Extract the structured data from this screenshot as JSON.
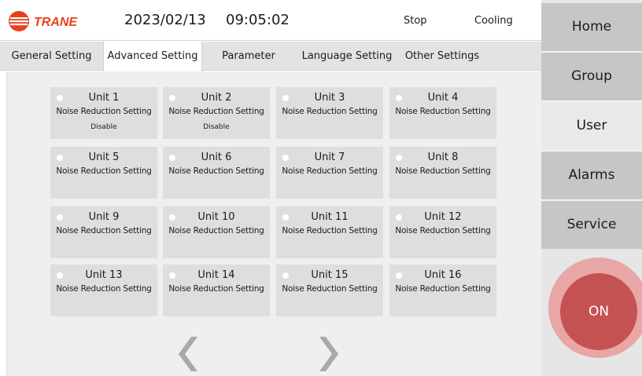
{
  "header": {
    "brand": "TRANE",
    "date": "2023/02/13",
    "time": "09:05:02",
    "status": "Stop",
    "mode": "Cooling"
  },
  "tabs": [
    {
      "label": "General Setting",
      "active": false
    },
    {
      "label": "Advanced Setting",
      "active": true
    },
    {
      "label": "Parameter",
      "active": false
    },
    {
      "label": "Language Setting",
      "active": false
    },
    {
      "label": "Other Settings",
      "active": false
    }
  ],
  "units": [
    {
      "name": "Unit 1",
      "setting": "Noise Reduction Setting",
      "value": "Disable"
    },
    {
      "name": "Unit 2",
      "setting": "Noise Reduction Setting",
      "value": "Disable"
    },
    {
      "name": "Unit 3",
      "setting": "Noise Reduction Setting",
      "value": ""
    },
    {
      "name": "Unit 4",
      "setting": "Noise Reduction Setting",
      "value": ""
    },
    {
      "name": "Unit 5",
      "setting": "Noise Reduction Setting",
      "value": ""
    },
    {
      "name": "Unit 6",
      "setting": "Noise Reduction Setting",
      "value": ""
    },
    {
      "name": "Unit 7",
      "setting": "Noise Reduction Setting",
      "value": ""
    },
    {
      "name": "Unit 8",
      "setting": "Noise Reduction Setting",
      "value": ""
    },
    {
      "name": "Unit 9",
      "setting": "Noise Reduction Setting",
      "value": ""
    },
    {
      "name": "Unit 10",
      "setting": "Noise Reduction Setting",
      "value": ""
    },
    {
      "name": "Unit 11",
      "setting": "Noise Reduction Setting",
      "value": ""
    },
    {
      "name": "Unit 12",
      "setting": "Noise Reduction Setting",
      "value": ""
    },
    {
      "name": "Unit 13",
      "setting": "Noise Reduction Setting",
      "value": ""
    },
    {
      "name": "Unit 14",
      "setting": "Noise Reduction Setting",
      "value": ""
    },
    {
      "name": "Unit 15",
      "setting": "Noise Reduction Setting",
      "value": ""
    },
    {
      "name": "Unit 16",
      "setting": "Noise Reduction Setting",
      "value": ""
    }
  ],
  "pager": {
    "prev_icon": "chevron-left-icon",
    "next_icon": "chevron-right-icon"
  },
  "sidebar": {
    "items": [
      {
        "label": "Home",
        "active": false
      },
      {
        "label": "Group",
        "active": false
      },
      {
        "label": "User",
        "active": true
      },
      {
        "label": "Alarms",
        "active": false
      },
      {
        "label": "Service",
        "active": false
      }
    ],
    "power_label": "ON"
  },
  "colors": {
    "brand_red": "#e8401c",
    "power_button": "#c55252",
    "power_halo": "#e9a6a6",
    "tile": "#dedede",
    "nav": "#c6c6c6"
  }
}
